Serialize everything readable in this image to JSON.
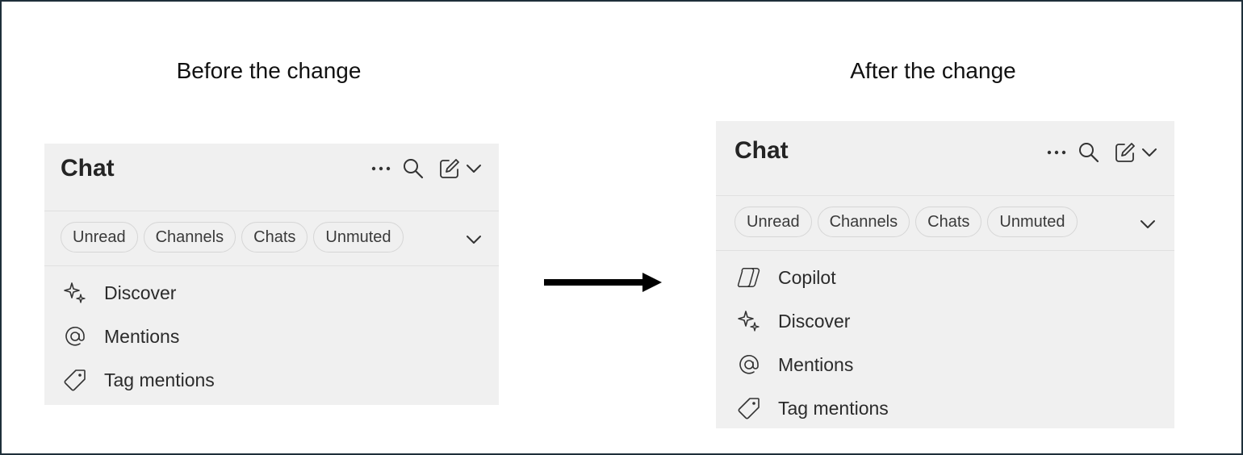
{
  "captions": {
    "before": "Before the change",
    "after": "After the change"
  },
  "before_panel": {
    "title": "Chat",
    "filters": [
      "Unread",
      "Channels",
      "Chats",
      "Unmuted"
    ],
    "items": [
      {
        "label": "Discover",
        "icon": "sparkle-icon"
      },
      {
        "label": "Mentions",
        "icon": "at-sign-icon"
      },
      {
        "label": "Tag mentions",
        "icon": "tag-icon"
      }
    ]
  },
  "after_panel": {
    "title": "Chat",
    "filters": [
      "Unread",
      "Channels",
      "Chats",
      "Unmuted"
    ],
    "items": [
      {
        "label": "Copilot",
        "icon": "copilot-icon"
      },
      {
        "label": "Discover",
        "icon": "sparkle-icon"
      },
      {
        "label": "Mentions",
        "icon": "at-sign-icon"
      },
      {
        "label": "Tag mentions",
        "icon": "tag-icon"
      }
    ]
  },
  "header_icons": [
    "more-options-icon",
    "search-icon",
    "compose-icon",
    "chevron-down-icon"
  ],
  "colors": {
    "panel_bg": "#f0f0f0",
    "frame_border": "#1e2f3a",
    "text": "#242424"
  }
}
